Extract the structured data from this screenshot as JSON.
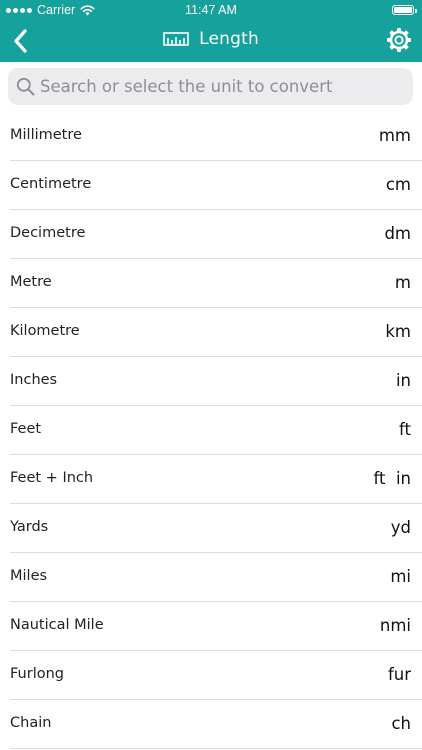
{
  "status_bar": {
    "carrier": "Carrier",
    "time": "11:47 AM",
    "wifi_icon": "wifi-icon",
    "battery_level": 1.0
  },
  "nav": {
    "back_icon": "chevron-left-icon",
    "title_icon": "ruler-icon",
    "title": "Length",
    "settings_icon": "gear-icon"
  },
  "search": {
    "icon": "search-icon",
    "placeholder": "Search or select the unit to convert",
    "value": ""
  },
  "colors": {
    "header_bg": "#15a19c",
    "header_fg": "#ffffff",
    "search_bg": "#ececee",
    "separator": "#dcdcde"
  },
  "units": [
    {
      "name": "Millimetre",
      "symbol": "mm"
    },
    {
      "name": "Centimetre",
      "symbol": "cm"
    },
    {
      "name": "Decimetre",
      "symbol": "dm"
    },
    {
      "name": "Metre",
      "symbol": "m"
    },
    {
      "name": "Kilometre",
      "symbol": "km"
    },
    {
      "name": "Inches",
      "symbol": "in"
    },
    {
      "name": "Feet",
      "symbol": "ft"
    },
    {
      "name": "Feet + Inch",
      "symbol": "ft  in"
    },
    {
      "name": "Yards",
      "symbol": "yd"
    },
    {
      "name": "Miles",
      "symbol": "mi"
    },
    {
      "name": "Nautical Mile",
      "symbol": "nmi"
    },
    {
      "name": "Furlong",
      "symbol": "fur"
    },
    {
      "name": "Chain",
      "symbol": "ch"
    }
  ]
}
